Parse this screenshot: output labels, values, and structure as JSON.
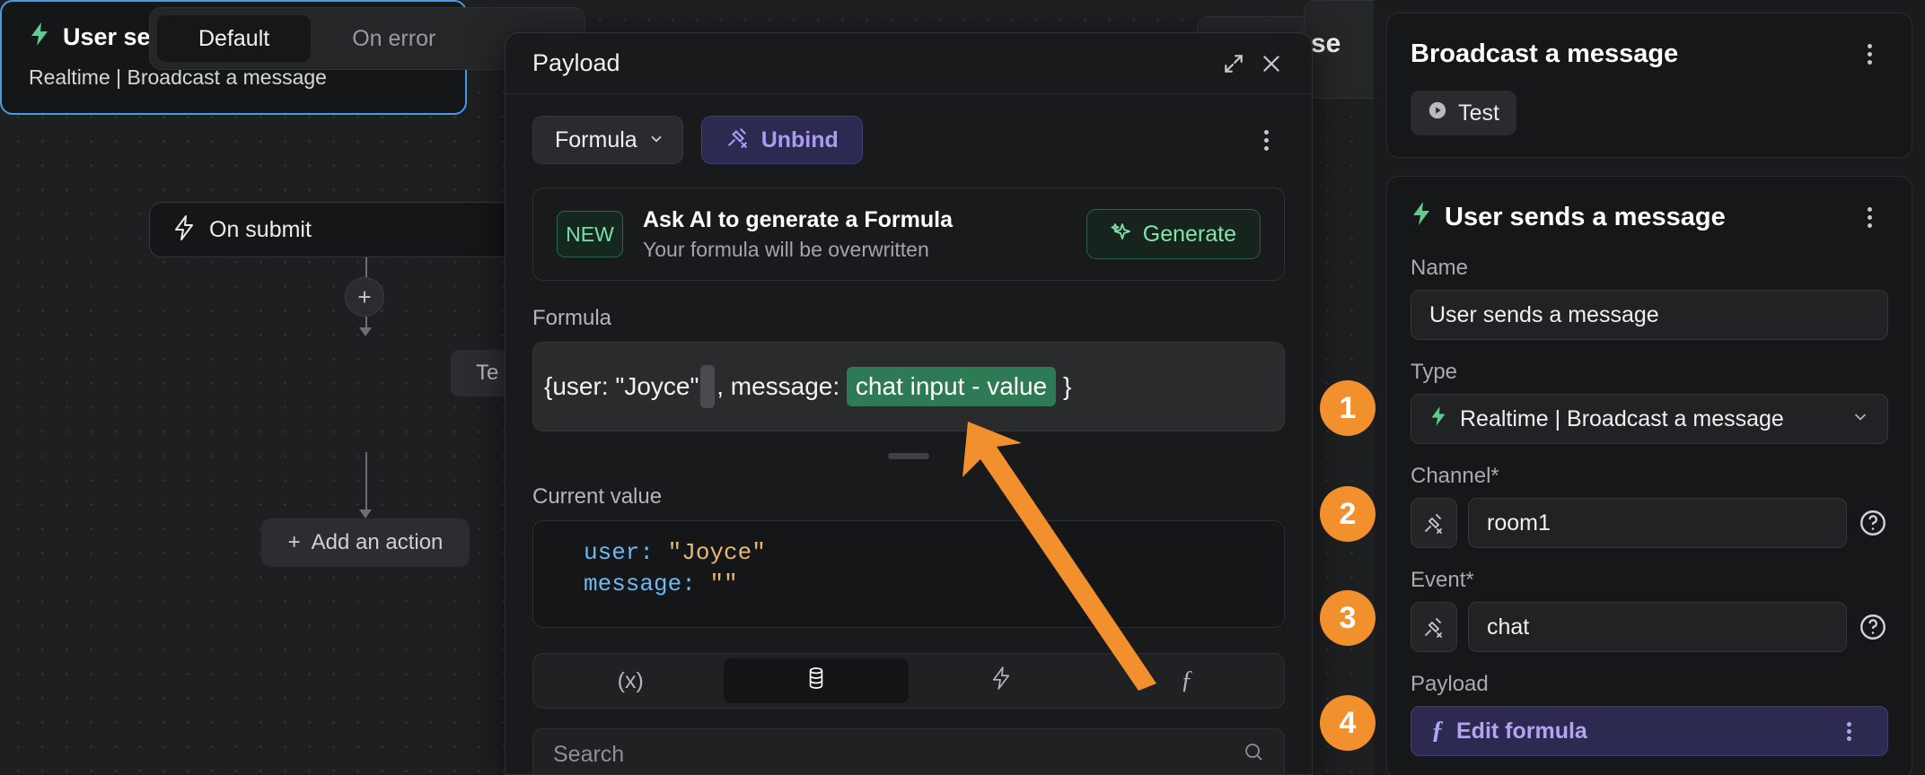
{
  "canvas": {
    "tabs": [
      {
        "label": "Default",
        "active": true
      },
      {
        "label": "On error",
        "active": false
      }
    ],
    "nodes": {
      "submit": {
        "label": "On submit",
        "icon": "lightning-icon"
      },
      "main": {
        "title": "User sends a message",
        "subtitle": "Realtime | Broadcast a message",
        "icon": "lightning-icon",
        "test_pill": "Te"
      }
    },
    "add_action_label": "Add an action",
    "plus_label": "+",
    "ghost_card_text": "se"
  },
  "dialog": {
    "title": "Payload",
    "expand_icon": "expand-icon",
    "close_icon": "close-icon",
    "mode_button": "Formula",
    "unbind_button": "Unbind",
    "kebab_icon": "kebab-menu-icon",
    "ai_promo": {
      "badge": "NEW",
      "headline": "Ask AI to generate a Formula",
      "subtext": "Your formula will be overwritten",
      "button": "Generate"
    },
    "formula_section": {
      "label": "Formula",
      "prefix": "{user: \"Joyce\"",
      "middle": ", message:",
      "token": "chat input - value",
      "suffix": "}"
    },
    "current_value": {
      "label": "Current value",
      "lines": [
        {
          "key": "user:",
          "value": "\"Joyce\""
        },
        {
          "key": "message:",
          "value": "\"\""
        }
      ]
    },
    "segments": [
      {
        "icon": "variable-icon",
        "glyph": "(x)",
        "active": false
      },
      {
        "icon": "database-icon",
        "glyph": "",
        "active": true
      },
      {
        "icon": "lightning-icon",
        "glyph": "",
        "active": false
      },
      {
        "icon": "function-icon",
        "glyph": "ƒ",
        "active": false
      }
    ],
    "search": {
      "placeholder": "Search",
      "value": "Search",
      "icon": "search-icon"
    }
  },
  "inspector": {
    "broadcast_card": {
      "title": "Broadcast a message",
      "kebab_icon": "kebab-menu-icon",
      "test_button": "Test",
      "test_icon": "play-icon"
    },
    "event_card": {
      "title": "User sends a message",
      "icon": "lightning-icon",
      "kebab_icon": "kebab-menu-icon",
      "fields": {
        "name": {
          "label": "Name",
          "value": "User sends a message"
        },
        "type": {
          "label": "Type",
          "value": "Realtime | Broadcast a message",
          "icon": "lightning-icon",
          "chevron": "chevron-down-icon"
        },
        "channel": {
          "label": "Channel",
          "required": "*",
          "value": "room1",
          "bind_icon": "unbind-icon",
          "help_icon": "help-circle-icon"
        },
        "event": {
          "label": "Event",
          "required": "*",
          "value": "chat",
          "bind_icon": "unbind-icon",
          "help_icon": "help-circle-icon"
        },
        "payload": {
          "label": "Payload",
          "button": "Edit formula",
          "icon": "function-icon",
          "kebab_icon": "kebab-menu-icon"
        }
      }
    }
  },
  "annotations": {
    "badges": [
      "1",
      "2",
      "3",
      "4"
    ],
    "arrow_color": "#f2902d"
  },
  "colors": {
    "accent_orange": "#f2902d",
    "accent_purple": "#a99bf0",
    "accent_green": "#5ccd8e",
    "selection_blue": "#4a9ae8",
    "token_green": "#2d7a54"
  }
}
